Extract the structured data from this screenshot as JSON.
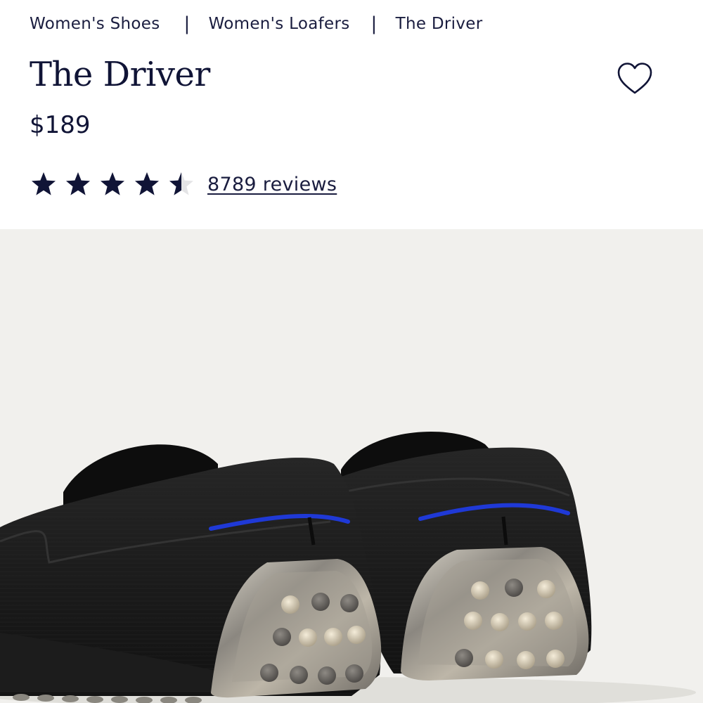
{
  "breadcrumb": {
    "items": [
      "Women's Shoes",
      "Women's Loafers",
      "The Driver"
    ],
    "separator": "|"
  },
  "product": {
    "title": "The Driver",
    "price": "$189",
    "rating": 4.5,
    "rating_max": 5,
    "reviews_label": "8789 reviews",
    "image_alt": "The Driver loafers, rear view"
  },
  "icons": {
    "favorite": "heart-outline-icon",
    "rating_star": "star-icon"
  },
  "colors": {
    "navy": "#101436",
    "text": "#1a1d3f",
    "image_bg": "#f1f0ed",
    "shoe_knit": "#1b1b1b",
    "accent_stripe": "#1f39d6"
  }
}
